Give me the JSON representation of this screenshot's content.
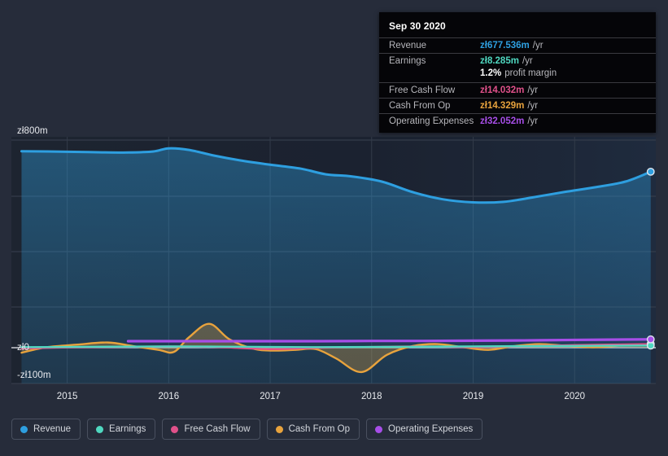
{
  "chart_data": {
    "type": "line",
    "title": "",
    "xlabel": "",
    "ylabel": "",
    "currency_symbol": "zł",
    "grid": true,
    "legend_position": "bottom",
    "x_ticks": [
      "2015",
      "2016",
      "2017",
      "2018",
      "2019",
      "2020"
    ],
    "y_ticks": [
      "zł800m",
      "zł0",
      "-zł100m"
    ],
    "ylim": [
      -100,
      800
    ],
    "series": [
      {
        "name": "Revenue",
        "color": "#2e9fe0",
        "fill": true,
        "x": [
          2014.55,
          2015.0,
          2015.3,
          2015.6,
          2015.85,
          2016.0,
          2016.2,
          2016.45,
          2016.7,
          2017.0,
          2017.3,
          2017.55,
          2017.8,
          2018.1,
          2018.4,
          2018.7,
          2019.0,
          2019.3,
          2019.6,
          2019.9,
          2020.2,
          2020.5,
          2020.75
        ],
        "values": [
          757,
          755,
          753,
          752,
          756,
          768,
          762,
          740,
          722,
          705,
          690,
          668,
          660,
          640,
          600,
          572,
          560,
          562,
          580,
          600,
          618,
          640,
          678
        ]
      },
      {
        "name": "Earnings",
        "color": "#4fd8c0",
        "fill": false,
        "x": [
          2014.55,
          2015.0,
          2015.5,
          2016.0,
          2016.5,
          2017.0,
          2017.5,
          2018.0,
          2018.5,
          2019.0,
          2019.5,
          2020.0,
          2020.75
        ],
        "values": [
          2,
          3,
          4,
          5,
          4,
          3,
          2,
          3,
          4,
          5,
          6,
          7,
          8.285
        ]
      },
      {
        "name": "Free Cash Flow",
        "color": "#e0518a",
        "fill": false,
        "x": [
          2014.55,
          2015.0,
          2015.5,
          2016.0,
          2016.5,
          2017.0,
          2017.5,
          2018.0,
          2018.5,
          2019.0,
          2019.5,
          2020.0,
          2020.75
        ],
        "values": [
          -2,
          1,
          3,
          5,
          2,
          -4,
          0,
          3,
          5,
          2,
          6,
          10,
          14.032
        ]
      },
      {
        "name": "Cash From Op",
        "color": "#e8a33d",
        "fill": true,
        "x": [
          2014.55,
          2014.8,
          2015.1,
          2015.4,
          2015.65,
          2015.9,
          2016.05,
          2016.2,
          2016.4,
          2016.6,
          2016.85,
          2017.05,
          2017.25,
          2017.45,
          2017.65,
          2017.9,
          2018.15,
          2018.4,
          2018.65,
          2018.9,
          2019.15,
          2019.4,
          2019.65,
          2019.9,
          2020.2,
          2020.5,
          2020.75
        ],
        "values": [
          -14,
          2,
          12,
          20,
          6,
          -6,
          -12,
          40,
          92,
          32,
          -4,
          -8,
          -6,
          -4,
          -30,
          -68,
          -20,
          6,
          14,
          2,
          -6,
          6,
          14,
          8,
          2,
          10,
          14.329
        ]
      },
      {
        "name": "Operating Expenses",
        "color": "#a74ee8",
        "fill": false,
        "x": [
          2015.6,
          2016.0,
          2016.5,
          2017.0,
          2017.5,
          2018.0,
          2018.5,
          2019.0,
          2019.5,
          2020.0,
          2020.75
        ],
        "values": [
          25,
          25,
          25,
          25,
          25,
          26,
          26,
          27,
          28,
          30,
          32.052
        ]
      }
    ]
  },
  "tooltip": {
    "title": "Sep 30 2020",
    "rows": [
      {
        "key": "Revenue",
        "value": "zł677.536m",
        "suffix": "/yr",
        "color": "#2e9fe0"
      },
      {
        "key": "Earnings",
        "value": "zł8.285m",
        "suffix": "/yr",
        "color": "#4fd8c0"
      },
      {
        "key": "",
        "value": "1.2%",
        "suffix": "profit margin",
        "color": "#ffffff"
      },
      {
        "key": "Free Cash Flow",
        "value": "zł14.032m",
        "suffix": "/yr",
        "color": "#e0518a"
      },
      {
        "key": "Cash From Op",
        "value": "zł14.329m",
        "suffix": "/yr",
        "color": "#e8a33d"
      },
      {
        "key": "Operating Expenses",
        "value": "zł32.052m",
        "suffix": "/yr",
        "color": "#a74ee8"
      }
    ]
  },
  "legend": {
    "items": [
      {
        "label": "Revenue",
        "color": "#2e9fe0"
      },
      {
        "label": "Earnings",
        "color": "#4fd8c0"
      },
      {
        "label": "Free Cash Flow",
        "color": "#e0518a"
      },
      {
        "label": "Cash From Op",
        "color": "#e8a33d"
      },
      {
        "label": "Operating Expenses",
        "color": "#a74ee8"
      }
    ]
  },
  "axes": {
    "y": [
      {
        "label": "zł800m"
      },
      {
        "label": "zł0"
      },
      {
        "label": "-zł100m"
      }
    ],
    "x": [
      {
        "label": "2015"
      },
      {
        "label": "2016"
      },
      {
        "label": "2017"
      },
      {
        "label": "2018"
      },
      {
        "label": "2019"
      },
      {
        "label": "2020"
      }
    ]
  }
}
